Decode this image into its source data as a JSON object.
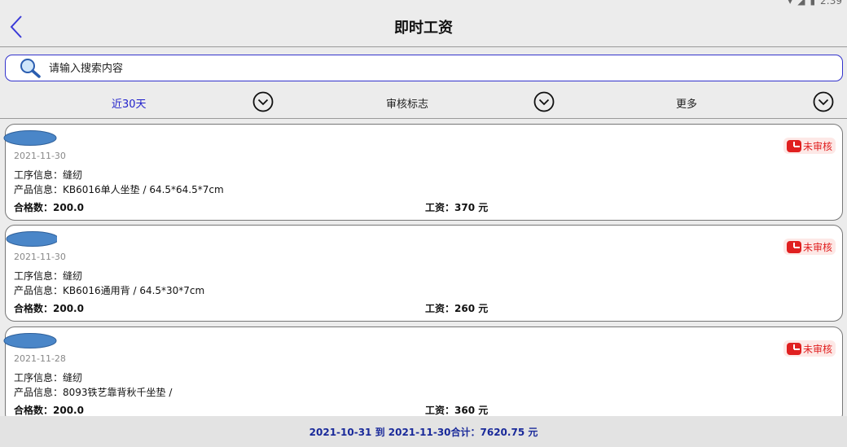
{
  "status": {
    "time": "2:39"
  },
  "header": {
    "title": "即时工资"
  },
  "search": {
    "placeholder": "请输入搜索内容"
  },
  "filters": [
    {
      "label": "近30天",
      "active": true
    },
    {
      "label": "审核标志",
      "active": false
    },
    {
      "label": "更多",
      "active": false
    }
  ],
  "records": [
    {
      "date": "2021-11-30",
      "process": "工序信息：缝纫",
      "product": "产品信息：KB6016单人坐垫 / 64.5*64.5*7cm",
      "qualified": "合格数：200.0",
      "wage": "工资：370 元",
      "status": "未审核"
    },
    {
      "date": "2021-11-30",
      "process": "工序信息：缝纫",
      "product": "产品信息：KB6016通用背 / 64.5*30*7cm",
      "qualified": "合格数：200.0",
      "wage": "工资：260 元",
      "status": "未审核"
    },
    {
      "date": "2021-11-28",
      "process": "工序信息：缝纫",
      "product": "产品信息：8093铁艺靠背秋千坐垫 /",
      "qualified": "合格数：200.0",
      "wage": "工资：360 元",
      "status": "未审核"
    }
  ],
  "summary": {
    "text": "2021-10-31 到 2021-11-30合计：7620.75 元"
  },
  "colors": {
    "accent": "#2222cc",
    "badge_red": "#e02020",
    "avatar_blue": "#4a86c8"
  }
}
